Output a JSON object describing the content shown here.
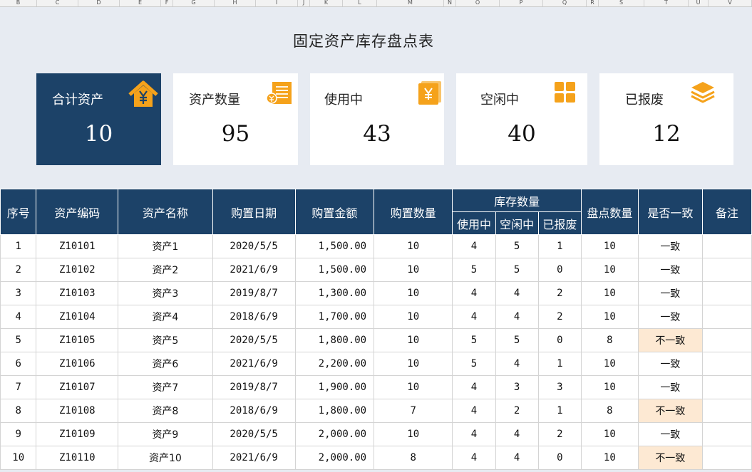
{
  "column_headers": [
    "B",
    "C",
    "D",
    "E",
    "F",
    "G",
    "H",
    "I",
    "J",
    "K",
    "L",
    "M",
    "N",
    "O",
    "P",
    "Q",
    "R",
    "S",
    "T",
    "U",
    "V"
  ],
  "title": "固定资产库存盘点表",
  "summary_cards": [
    {
      "label": "合计资产",
      "value": "10",
      "icon": "house-yen-icon"
    },
    {
      "label": "资产数量",
      "value": "95",
      "icon": "coin-document-icon"
    },
    {
      "label": "使用中",
      "value": "43",
      "icon": "yen-card-icon"
    },
    {
      "label": "空闲中",
      "value": "40",
      "icon": "grid-squares-icon"
    },
    {
      "label": "已报废",
      "value": "12",
      "icon": "stacked-layers-icon"
    }
  ],
  "table": {
    "headers": {
      "seq": "序号",
      "code": "资产编码",
      "name": "资产名称",
      "date": "购置日期",
      "amount": "购置金额",
      "qty": "购置数量",
      "stock": "库存数量",
      "in_use": "使用中",
      "idle": "空闲中",
      "scrapped": "已报废",
      "count": "盘点数量",
      "consistent": "是否一致",
      "remark": "备注"
    },
    "rows": [
      [
        "1",
        "Z10101",
        "资产1",
        "2020/5/5",
        "1,500.00",
        "10",
        "4",
        "5",
        "1",
        "10",
        "一致",
        ""
      ],
      [
        "2",
        "Z10102",
        "资产2",
        "2021/6/9",
        "1,500.00",
        "10",
        "5",
        "5",
        "0",
        "10",
        "一致",
        ""
      ],
      [
        "3",
        "Z10103",
        "资产3",
        "2019/8/7",
        "1,300.00",
        "10",
        "4",
        "4",
        "2",
        "10",
        "一致",
        ""
      ],
      [
        "4",
        "Z10104",
        "资产4",
        "2018/6/9",
        "1,700.00",
        "10",
        "4",
        "4",
        "2",
        "10",
        "一致",
        ""
      ],
      [
        "5",
        "Z10105",
        "资产5",
        "2020/5/5",
        "1,800.00",
        "10",
        "5",
        "5",
        "0",
        "8",
        "不一致",
        ""
      ],
      [
        "6",
        "Z10106",
        "资产6",
        "2021/6/9",
        "2,200.00",
        "10",
        "5",
        "4",
        "1",
        "10",
        "一致",
        ""
      ],
      [
        "7",
        "Z10107",
        "资产7",
        "2019/8/7",
        "1,900.00",
        "10",
        "4",
        "3",
        "3",
        "10",
        "一致",
        ""
      ],
      [
        "8",
        "Z10108",
        "资产8",
        "2018/6/9",
        "1,800.00",
        "7",
        "4",
        "2",
        "1",
        "8",
        "不一致",
        ""
      ],
      [
        "9",
        "Z10109",
        "资产9",
        "2020/5/5",
        "2,000.00",
        "10",
        "4",
        "4",
        "2",
        "10",
        "一致",
        ""
      ],
      [
        "10",
        "Z10110",
        "资产10",
        "2021/6/9",
        "2,000.00",
        "8",
        "4",
        "4",
        "0",
        "10",
        "不一致",
        ""
      ]
    ]
  },
  "colors": {
    "header_bg": "#1c4268",
    "accent_orange": "#f5a21b",
    "mismatch_bg": "#fde9d3"
  }
}
